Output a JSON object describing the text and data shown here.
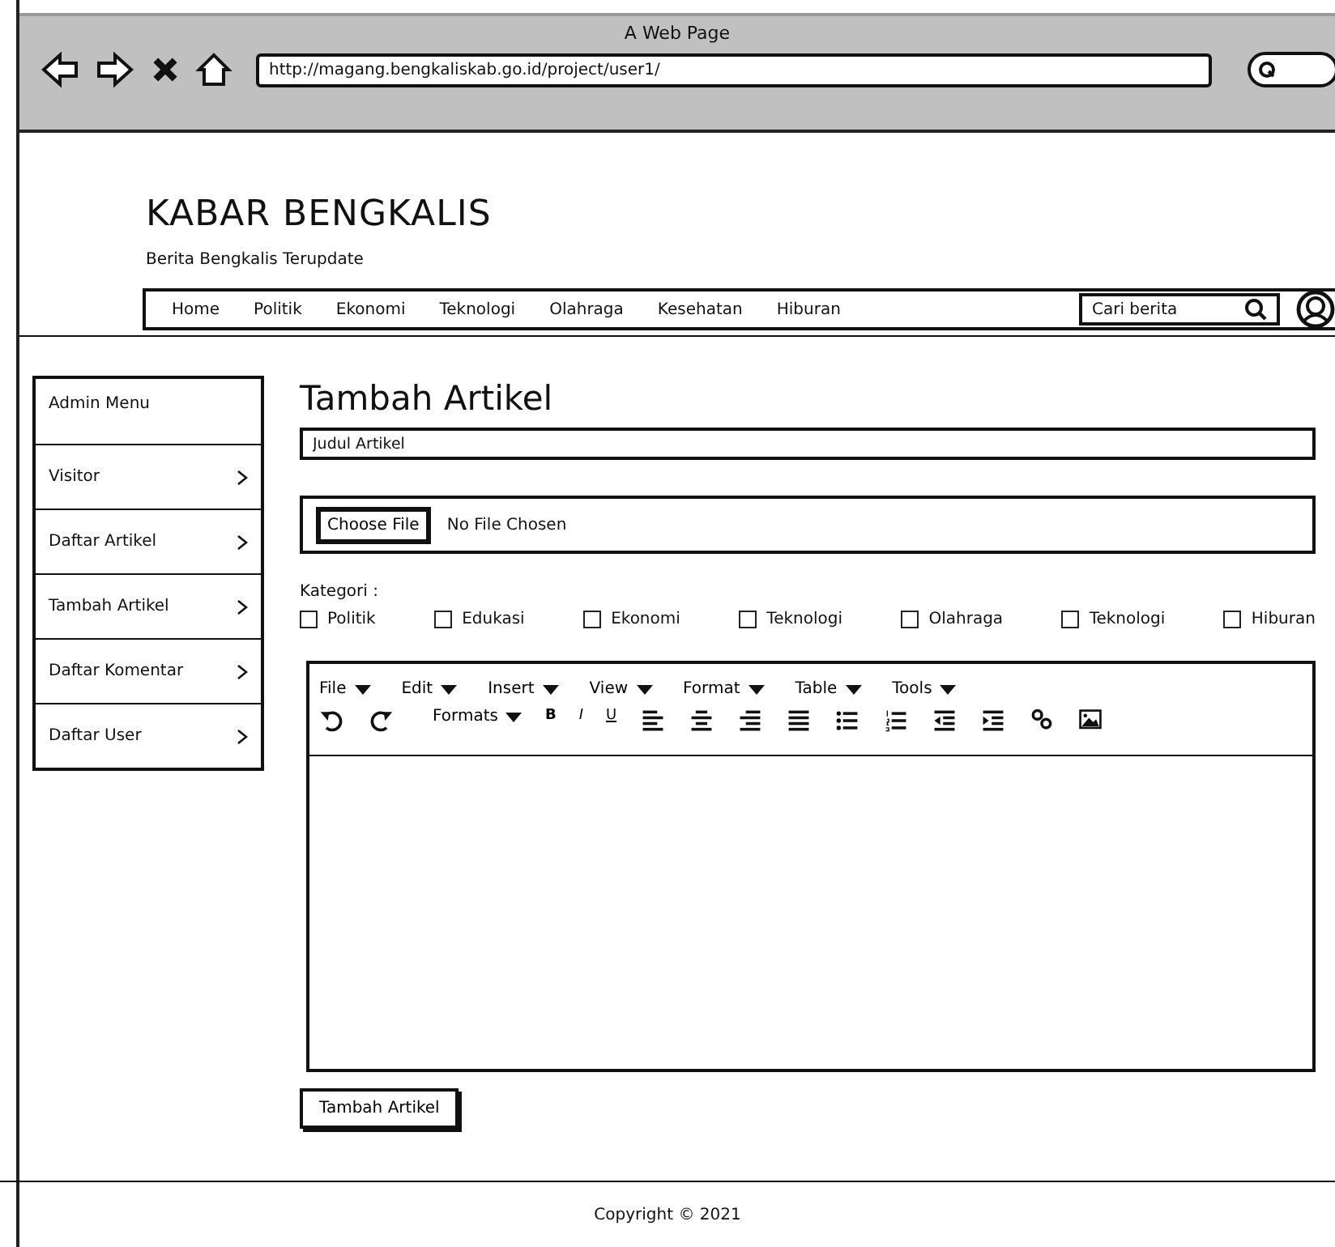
{
  "window": {
    "title": "A Web Page",
    "url": "http://magang.bengkaliskab.go.id/project/user1/"
  },
  "header": {
    "title": "KABAR BENGKALIS",
    "subtitle": "Berita Bengkalis Terupdate"
  },
  "nav": {
    "items": [
      "Home",
      "Politik",
      "Ekonomi",
      "Teknologi",
      "Olahraga",
      "Kesehatan",
      "Hiburan"
    ],
    "search": {
      "placeholder": "Cari berita"
    }
  },
  "sidebar": {
    "items": [
      {
        "label": "Admin Menu",
        "kind": "header"
      },
      {
        "label": "Visitor",
        "kind": "link"
      },
      {
        "label": "Daftar Artikel",
        "kind": "link"
      },
      {
        "label": "Tambah Artikel",
        "kind": "link"
      },
      {
        "label": "Daftar Komentar",
        "kind": "link"
      },
      {
        "label": "Daftar User",
        "kind": "link"
      }
    ]
  },
  "form": {
    "title": "Tambah Artikel",
    "title_field": {
      "placeholder": "Judul Artikel"
    },
    "file": {
      "button": "Choose File",
      "status": "No File Chosen"
    },
    "category_label": "Kategori :",
    "categories": [
      {
        "label": "Politik",
        "checked": false
      },
      {
        "label": "Edukasi",
        "checked": false
      },
      {
        "label": "Ekonomi",
        "checked": false
      },
      {
        "label": "Teknologi",
        "checked": false
      },
      {
        "label": "Olahraga",
        "checked": false
      },
      {
        "label": "Teknologi",
        "checked": false
      },
      {
        "label": "Hiburan",
        "checked": false
      }
    ],
    "editor": {
      "menus": [
        "File",
        "Edit",
        "Insert",
        "View",
        "Format",
        "Table",
        "Tools"
      ],
      "formats": "Formats",
      "style_buttons": [
        "B",
        "I",
        "U"
      ]
    },
    "submit": "Tambah Artikel"
  },
  "footer": {
    "copyright": "Copyright © 2021"
  }
}
